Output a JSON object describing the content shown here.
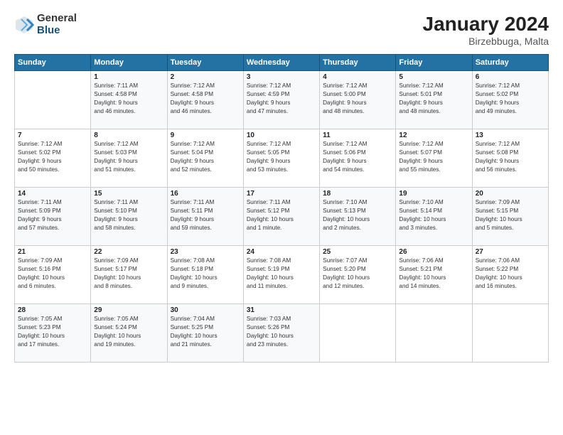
{
  "logo": {
    "general": "General",
    "blue": "Blue"
  },
  "title": "January 2024",
  "subtitle": "Birzebbuga, Malta",
  "header_days": [
    "Sunday",
    "Monday",
    "Tuesday",
    "Wednesday",
    "Thursday",
    "Friday",
    "Saturday"
  ],
  "weeks": [
    [
      {
        "day": "",
        "info": ""
      },
      {
        "day": "1",
        "info": "Sunrise: 7:11 AM\nSunset: 4:58 PM\nDaylight: 9 hours\nand 46 minutes."
      },
      {
        "day": "2",
        "info": "Sunrise: 7:12 AM\nSunset: 4:58 PM\nDaylight: 9 hours\nand 46 minutes."
      },
      {
        "day": "3",
        "info": "Sunrise: 7:12 AM\nSunset: 4:59 PM\nDaylight: 9 hours\nand 47 minutes."
      },
      {
        "day": "4",
        "info": "Sunrise: 7:12 AM\nSunset: 5:00 PM\nDaylight: 9 hours\nand 48 minutes."
      },
      {
        "day": "5",
        "info": "Sunrise: 7:12 AM\nSunset: 5:01 PM\nDaylight: 9 hours\nand 48 minutes."
      },
      {
        "day": "6",
        "info": "Sunrise: 7:12 AM\nSunset: 5:02 PM\nDaylight: 9 hours\nand 49 minutes."
      }
    ],
    [
      {
        "day": "7",
        "info": "Sunrise: 7:12 AM\nSunset: 5:02 PM\nDaylight: 9 hours\nand 50 minutes."
      },
      {
        "day": "8",
        "info": "Sunrise: 7:12 AM\nSunset: 5:03 PM\nDaylight: 9 hours\nand 51 minutes."
      },
      {
        "day": "9",
        "info": "Sunrise: 7:12 AM\nSunset: 5:04 PM\nDaylight: 9 hours\nand 52 minutes."
      },
      {
        "day": "10",
        "info": "Sunrise: 7:12 AM\nSunset: 5:05 PM\nDaylight: 9 hours\nand 53 minutes."
      },
      {
        "day": "11",
        "info": "Sunrise: 7:12 AM\nSunset: 5:06 PM\nDaylight: 9 hours\nand 54 minutes."
      },
      {
        "day": "12",
        "info": "Sunrise: 7:12 AM\nSunset: 5:07 PM\nDaylight: 9 hours\nand 55 minutes."
      },
      {
        "day": "13",
        "info": "Sunrise: 7:12 AM\nSunset: 5:08 PM\nDaylight: 9 hours\nand 56 minutes."
      }
    ],
    [
      {
        "day": "14",
        "info": "Sunrise: 7:11 AM\nSunset: 5:09 PM\nDaylight: 9 hours\nand 57 minutes."
      },
      {
        "day": "15",
        "info": "Sunrise: 7:11 AM\nSunset: 5:10 PM\nDaylight: 9 hours\nand 58 minutes."
      },
      {
        "day": "16",
        "info": "Sunrise: 7:11 AM\nSunset: 5:11 PM\nDaylight: 9 hours\nand 59 minutes."
      },
      {
        "day": "17",
        "info": "Sunrise: 7:11 AM\nSunset: 5:12 PM\nDaylight: 10 hours\nand 1 minute."
      },
      {
        "day": "18",
        "info": "Sunrise: 7:10 AM\nSunset: 5:13 PM\nDaylight: 10 hours\nand 2 minutes."
      },
      {
        "day": "19",
        "info": "Sunrise: 7:10 AM\nSunset: 5:14 PM\nDaylight: 10 hours\nand 3 minutes."
      },
      {
        "day": "20",
        "info": "Sunrise: 7:09 AM\nSunset: 5:15 PM\nDaylight: 10 hours\nand 5 minutes."
      }
    ],
    [
      {
        "day": "21",
        "info": "Sunrise: 7:09 AM\nSunset: 5:16 PM\nDaylight: 10 hours\nand 6 minutes."
      },
      {
        "day": "22",
        "info": "Sunrise: 7:09 AM\nSunset: 5:17 PM\nDaylight: 10 hours\nand 8 minutes."
      },
      {
        "day": "23",
        "info": "Sunrise: 7:08 AM\nSunset: 5:18 PM\nDaylight: 10 hours\nand 9 minutes."
      },
      {
        "day": "24",
        "info": "Sunrise: 7:08 AM\nSunset: 5:19 PM\nDaylight: 10 hours\nand 11 minutes."
      },
      {
        "day": "25",
        "info": "Sunrise: 7:07 AM\nSunset: 5:20 PM\nDaylight: 10 hours\nand 12 minutes."
      },
      {
        "day": "26",
        "info": "Sunrise: 7:06 AM\nSunset: 5:21 PM\nDaylight: 10 hours\nand 14 minutes."
      },
      {
        "day": "27",
        "info": "Sunrise: 7:06 AM\nSunset: 5:22 PM\nDaylight: 10 hours\nand 16 minutes."
      }
    ],
    [
      {
        "day": "28",
        "info": "Sunrise: 7:05 AM\nSunset: 5:23 PM\nDaylight: 10 hours\nand 17 minutes."
      },
      {
        "day": "29",
        "info": "Sunrise: 7:05 AM\nSunset: 5:24 PM\nDaylight: 10 hours\nand 19 minutes."
      },
      {
        "day": "30",
        "info": "Sunrise: 7:04 AM\nSunset: 5:25 PM\nDaylight: 10 hours\nand 21 minutes."
      },
      {
        "day": "31",
        "info": "Sunrise: 7:03 AM\nSunset: 5:26 PM\nDaylight: 10 hours\nand 23 minutes."
      },
      {
        "day": "",
        "info": ""
      },
      {
        "day": "",
        "info": ""
      },
      {
        "day": "",
        "info": ""
      }
    ]
  ]
}
